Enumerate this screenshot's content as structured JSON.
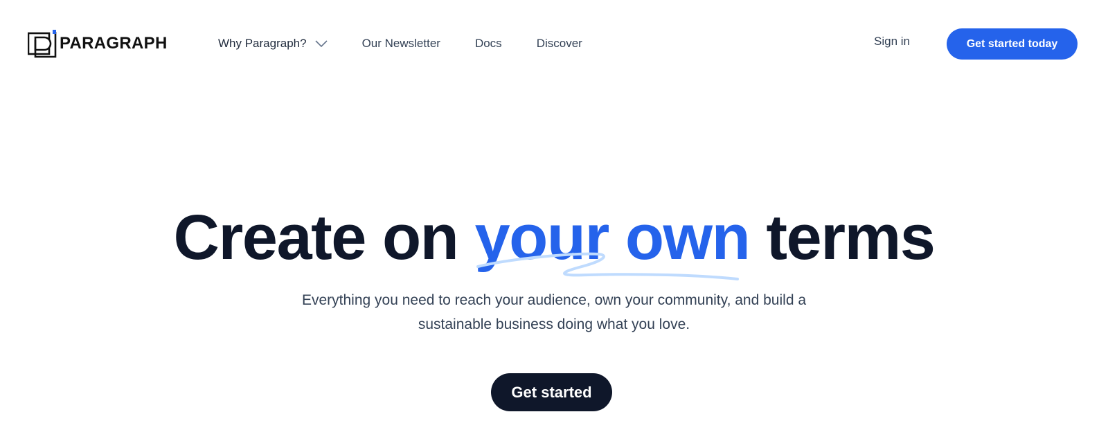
{
  "brand": {
    "name": "PARAGRAPH",
    "logo_icon": "paragraph-p-logo-icon",
    "accent_color": "#2563eb",
    "dark_color": "#0f172a"
  },
  "nav": {
    "items": [
      {
        "label": "Why Paragraph?",
        "has_dropdown": true,
        "icon": "chevron-down-icon"
      },
      {
        "label": "Our Newsletter"
      },
      {
        "label": "Docs"
      },
      {
        "label": "Discover"
      }
    ],
    "sign_in": "Sign in",
    "cta": "Get started today"
  },
  "hero": {
    "title_before": "Create on ",
    "title_accent": "your own",
    "title_after": " terms",
    "subtitle_line1": "Everything you need to reach your audience, own your community, and build a",
    "subtitle_line2": "sustainable business doing what you love.",
    "cta": "Get started",
    "scribble_color": "#bfdbfe"
  }
}
